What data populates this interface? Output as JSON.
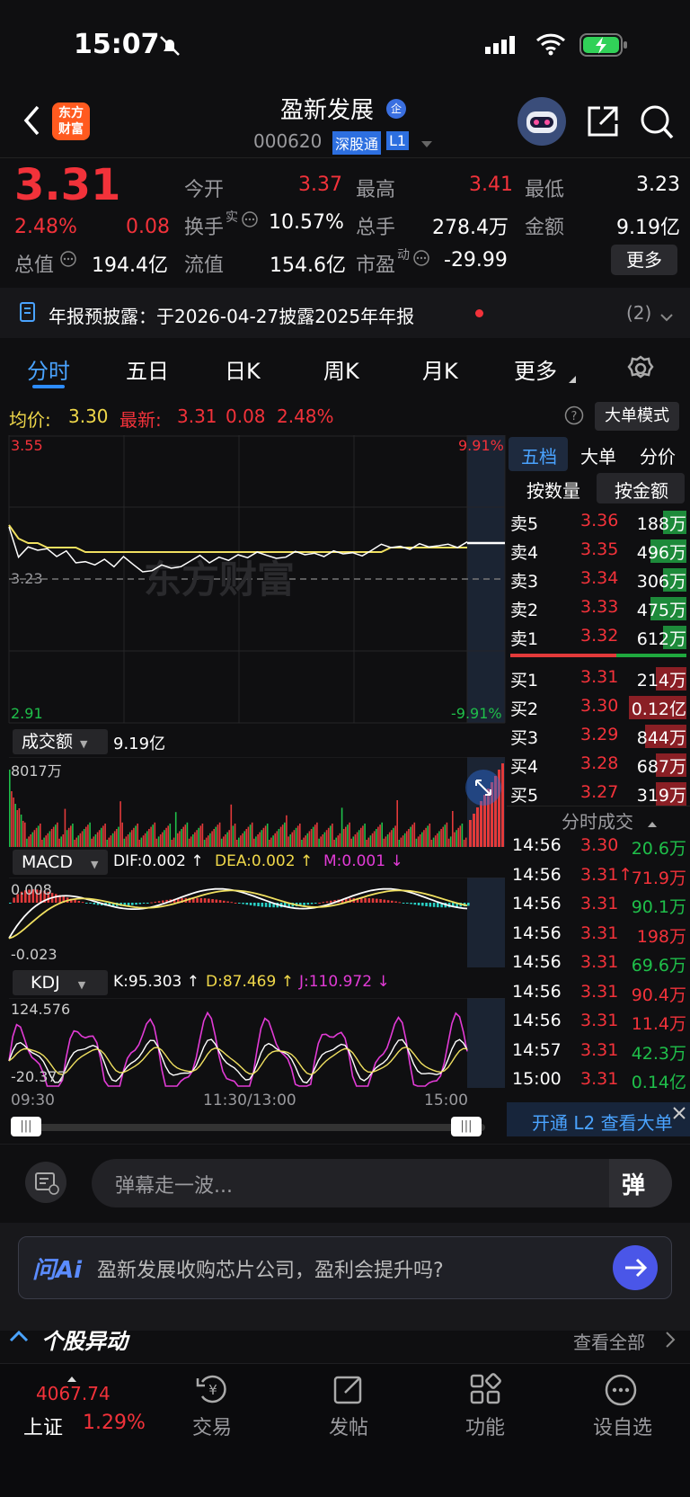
{
  "status_bar": {
    "time": "15:07"
  },
  "header": {
    "stock_name": "盈新发展",
    "badge": "企",
    "code": "000620",
    "channel": "深股通",
    "level": "L1",
    "logo_line1": "东方",
    "logo_line2": "财富"
  },
  "quote": {
    "price": "3.31",
    "change_pct": "2.48%",
    "change": "0.08",
    "open_label": "今开",
    "open": "3.37",
    "high_label": "最高",
    "high": "3.41",
    "low_label": "最低",
    "low": "3.23",
    "turnover_label": "换手",
    "turnover_sup": "实",
    "turnover": "10.57%",
    "volume_label": "总手",
    "volume": "278.4万",
    "amount_label": "金额",
    "amount": "9.19亿",
    "mktcap_label": "总值",
    "mktcap": "194.4亿",
    "float_label": "流值",
    "float_cap": "154.6亿",
    "pe_label": "市盈",
    "pe_sup": "动",
    "pe": "-29.99",
    "more": "更多"
  },
  "notice": {
    "text": "年报预披露：于2026-04-27披露2025年年报",
    "count": "(2)"
  },
  "tabs": [
    "分时",
    "五日",
    "日K",
    "周K",
    "月K",
    "更多"
  ],
  "info_line": {
    "avg_label": "均价:",
    "avg": "3.30",
    "latest_label": "最新:",
    "latest": "3.31",
    "chg": "0.08",
    "pct": "2.48%",
    "mode": "大单模式"
  },
  "price_chart": {
    "top": "3.55",
    "top_pct": "9.91%",
    "mid": "3.23",
    "bottom": "2.91",
    "bottom_pct": "-9.91%",
    "watermark": "东方财富",
    "chart_data": {
      "type": "line",
      "ylim": [
        2.91,
        3.55
      ],
      "reference": 3.23,
      "x": [
        0,
        5,
        10,
        15,
        20,
        25,
        30,
        35,
        40,
        45,
        50,
        55,
        60,
        65,
        70,
        75,
        80,
        85,
        90,
        95,
        100,
        105,
        110,
        115,
        120,
        125,
        130,
        135,
        140,
        145,
        150,
        155,
        160,
        165,
        170,
        175,
        180,
        185,
        190,
        195,
        200,
        205,
        210,
        215,
        220,
        225,
        230,
        235,
        240
      ],
      "series": [
        {
          "name": "最新",
          "values": [
            3.35,
            3.28,
            3.3,
            3.29,
            3.3,
            3.28,
            3.29,
            3.27,
            3.27,
            3.26,
            3.27,
            3.26,
            3.28,
            3.26,
            3.25,
            3.25,
            3.26,
            3.25,
            3.26,
            3.27,
            3.28,
            3.27,
            3.28,
            3.27,
            3.28,
            3.28,
            3.29,
            3.28,
            3.28,
            3.28,
            3.29,
            3.28,
            3.29,
            3.28,
            3.29,
            3.29,
            3.29,
            3.28,
            3.29,
            3.31,
            3.3,
            3.3,
            3.3,
            3.31,
            3.3,
            3.3,
            3.31,
            3.3,
            3.31
          ]
        },
        {
          "name": "均价",
          "values": [
            3.35,
            3.32,
            3.31,
            3.31,
            3.3,
            3.3,
            3.3,
            3.3,
            3.29,
            3.29,
            3.29,
            3.29,
            3.29,
            3.29,
            3.29,
            3.29,
            3.29,
            3.29,
            3.29,
            3.29,
            3.29,
            3.29,
            3.29,
            3.29,
            3.29,
            3.29,
            3.29,
            3.29,
            3.29,
            3.29,
            3.29,
            3.29,
            3.29,
            3.29,
            3.29,
            3.29,
            3.29,
            3.29,
            3.29,
            3.29,
            3.3,
            3.3,
            3.3,
            3.3,
            3.3,
            3.3,
            3.3,
            3.3,
            3.3
          ]
        }
      ]
    }
  },
  "volume_panel": {
    "label": "成交额",
    "total": "9.19亿",
    "max": "8017万"
  },
  "macd_panel": {
    "label": "MACD",
    "dif": "DIF:0.002 ↑",
    "dea": "DEA:0.002 ↑",
    "m": "M:0.001 ↓",
    "top": "0.008",
    "bottom": "-0.023"
  },
  "kdj_panel": {
    "label": "KDJ",
    "k": "K:95.303 ↑",
    "d": "D:87.469 ↑",
    "j": "J:110.972 ↓",
    "top": "124.576",
    "bottom": "-20.377"
  },
  "time_axis": [
    "09:30",
    "11:30/13:00",
    "15:00"
  ],
  "order_book": {
    "tabs": [
      "五档",
      "大单",
      "分价"
    ],
    "subtabs": [
      "按数量",
      "按金额"
    ],
    "asks": [
      {
        "label": "卖5",
        "price": "3.36",
        "amt": "188万"
      },
      {
        "label": "卖4",
        "price": "3.35",
        "amt": "496万"
      },
      {
        "label": "卖3",
        "price": "3.34",
        "amt": "306万"
      },
      {
        "label": "卖2",
        "price": "3.33",
        "amt": "475万"
      },
      {
        "label": "卖1",
        "price": "3.32",
        "amt": "612万"
      }
    ],
    "bids": [
      {
        "label": "买1",
        "price": "3.31",
        "amt": "214万"
      },
      {
        "label": "买2",
        "price": "3.30",
        "amt": "0.12亿"
      },
      {
        "label": "买3",
        "price": "3.29",
        "amt": "844万"
      },
      {
        "label": "买4",
        "price": "3.28",
        "amt": "687万"
      },
      {
        "label": "买5",
        "price": "3.27",
        "amt": "319万"
      }
    ]
  },
  "trades": {
    "title": "分时成交",
    "rows": [
      {
        "t": "14:56",
        "p": "3.30",
        "v": "20.6万",
        "c": "green"
      },
      {
        "t": "14:56",
        "p": "3.31↑",
        "v": "71.9万",
        "c": "red"
      },
      {
        "t": "14:56",
        "p": "3.31",
        "v": "90.1万",
        "c": "green"
      },
      {
        "t": "14:56",
        "p": "3.31",
        "v": "198万",
        "c": "red"
      },
      {
        "t": "14:56",
        "p": "3.31",
        "v": "69.6万",
        "c": "green"
      },
      {
        "t": "14:56",
        "p": "3.31",
        "v": "90.4万",
        "c": "red"
      },
      {
        "t": "14:56",
        "p": "3.31",
        "v": "11.4万",
        "c": "red"
      },
      {
        "t": "14:57",
        "p": "3.31",
        "v": "42.3万",
        "c": "green"
      },
      {
        "t": "15:00",
        "p": "3.31",
        "v": "0.14亿",
        "c": "green"
      }
    ],
    "l2": "开通 L2 查看大单"
  },
  "danmu": {
    "placeholder": "弹幕走一波...",
    "btn": "弹"
  },
  "ask_ai": {
    "brand": "问Ai",
    "question": "盈新发展收购芯片公司，盈利会提升吗?"
  },
  "section": {
    "title": "个股异动",
    "link": "查看全部"
  },
  "bottom_nav": {
    "index_value": "4067.74",
    "index_name": "上证",
    "index_pct": "1.29%",
    "items": [
      "交易",
      "发帖",
      "功能",
      "设自选"
    ]
  }
}
